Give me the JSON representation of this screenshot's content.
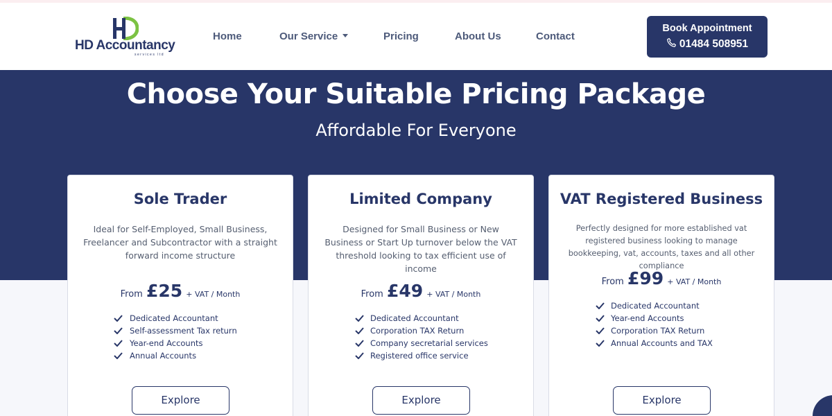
{
  "header": {
    "logo": {
      "brand": "HD Accountancy",
      "tagline": "services ltd"
    },
    "nav": [
      {
        "label": "Home"
      },
      {
        "label": "Our Service",
        "dropdown": true
      },
      {
        "label": "Pricing"
      },
      {
        "label": "About Us"
      },
      {
        "label": "Contact"
      }
    ],
    "cta": {
      "label": "Book Appointment",
      "phone": "01484 508951",
      "icon": "phone-icon"
    }
  },
  "hero": {
    "title": "Choose Your Suitable Pricing Package",
    "subtitle": "Affordable For Everyone"
  },
  "plans": [
    {
      "title": "Sole Trader",
      "description": "Ideal for Self-Employed, Small Business, Freelancer and Subcontractor with a straight forward income structure",
      "price_from": "From",
      "price": "£25",
      "price_suffix": "+ VAT / Month",
      "features": [
        "Dedicated Accountant",
        "Self-assessment Tax return",
        "Year-end Accounts",
        "Annual Accounts"
      ],
      "button": "Explore"
    },
    {
      "title": "Limited Company",
      "description": "Designed for Small Business or New Business or Start Up turnover below the VAT threshold looking to tax efficient use of income",
      "price_from": "From",
      "price": "£49",
      "price_suffix": "+ VAT / Month",
      "features": [
        "Dedicated Accountant",
        "Corporation TAX Return",
        "Company secretarial services",
        "Registered office service"
      ],
      "button": "Explore"
    },
    {
      "title": "VAT Registered Business",
      "description": "Perfectly designed for more established vat registered business looking to manage bookkeeping, vat, accounts, taxes and all other compliance",
      "price_from": "From",
      "price": "£99",
      "price_suffix": "+ VAT / Month",
      "features": [
        "Dedicated Accountant",
        "Year-end Accounts",
        "Corporation TAX Return",
        "Annual Accounts and TAX"
      ],
      "button": "Explore"
    }
  ],
  "colors": {
    "brand_navy": "#283668",
    "brand_green": "#7cc243",
    "nav_text": "#4d5a7a"
  }
}
